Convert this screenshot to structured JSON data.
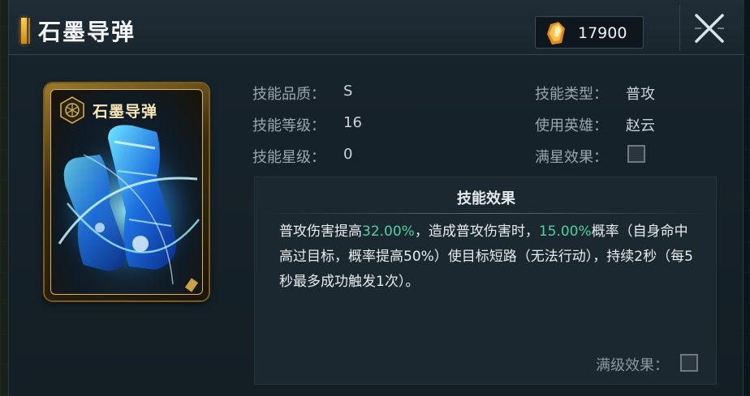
{
  "header": {
    "title": "石墨导弹",
    "currency": {
      "icon": "crystal-icon",
      "value": "17900"
    },
    "close_icon": "close-icon"
  },
  "card": {
    "title": "石墨导弹",
    "emblem_icon": "hexagon-emblem-icon",
    "art": "blue-energy-boots-illustration"
  },
  "stats": {
    "quality_label": "技能品质：",
    "quality_value": "S",
    "level_label": "技能等级：",
    "level_value": "16",
    "star_label": "技能星级：",
    "star_value": "0",
    "type_label": "技能类型：",
    "type_value": "普攻",
    "hero_label": "使用英雄：",
    "hero_value": "赵云",
    "max_star_label": "满星效果：",
    "max_star_checked": false
  },
  "effect": {
    "title": "技能效果",
    "segments": [
      {
        "text": "普攻伤害提高",
        "highlight": false
      },
      {
        "text": "32.00%",
        "highlight": true
      },
      {
        "text": "，造成普攻伤害时，",
        "highlight": false
      },
      {
        "text": "15.00%",
        "highlight": true
      },
      {
        "text": "概率（自身命中高过目标，概率提高50%）使目标短路（无法行动），持续2秒（每5秒最多成功触发1次）。",
        "highlight": false
      }
    ],
    "max_level_label": "满级效果：",
    "max_level_checked": false
  },
  "colors": {
    "highlight": "#4fd1a0",
    "gold": "#d8b35a",
    "background": "#131e25"
  }
}
